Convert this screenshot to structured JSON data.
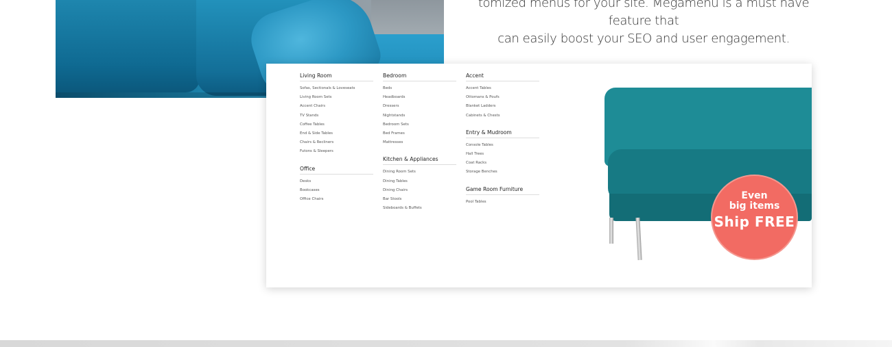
{
  "headline": {
    "line1": "tomized menus for your site. Megamenu is a must have feature that",
    "line2": "can easily boost your SEO and user engagement."
  },
  "megamenu": {
    "columns": [
      {
        "groups": [
          {
            "title": "Living Room",
            "items": [
              "Sofas, Sectionals & Loveseats",
              "Living Room Sets",
              "Accent Chairs",
              "TV Stands",
              "Coffee Tables",
              "End & Side Tables",
              "Chairs & Recliners",
              "Futons & Sleepers"
            ]
          },
          {
            "title": "Office",
            "items": [
              "Desks",
              "Bookcases",
              "Office Chairs"
            ]
          }
        ]
      },
      {
        "groups": [
          {
            "title": "Bedroom",
            "items": [
              "Beds",
              "Headboards",
              "Dressers",
              "Nightstands",
              "Bedroom Sets",
              "Bed Frames",
              "Mattresses"
            ]
          },
          {
            "title": "Kitchen & Appliances",
            "items": [
              "Dining Room Sets",
              "Dining Tables",
              "Dining Chairs",
              "Bar Stools",
              "Sideboards & Buffets"
            ]
          }
        ]
      },
      {
        "groups": [
          {
            "title": "Accent",
            "items": [
              "Accent Tables",
              "Ottomans & Poufs",
              "Blanket Ladders",
              "Cabinets & Chests"
            ]
          },
          {
            "title": "Entry & Mudroom",
            "items": [
              "Console Tables",
              "Hall Trees",
              "Coat Racks",
              "Storage Benches"
            ]
          },
          {
            "title": "Game Room Furniture",
            "items": [
              "Pool Tables"
            ]
          }
        ]
      }
    ],
    "promo_badge": {
      "line1": "Even",
      "line2": "big items",
      "line3": "Ship FREE",
      "color": "#f26b63"
    },
    "product_color": "#1e8c96"
  }
}
